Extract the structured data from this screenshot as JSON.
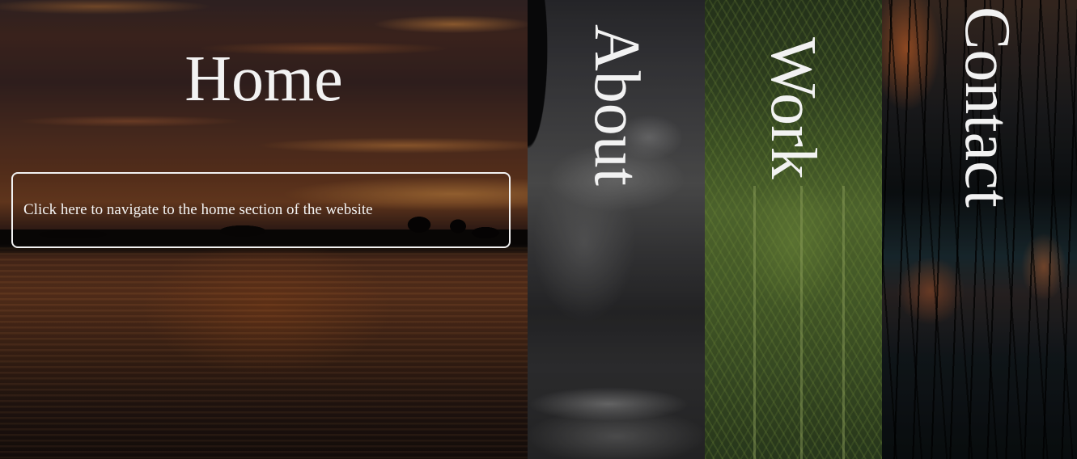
{
  "sections": {
    "home": {
      "title": "Home",
      "description": "Click here to navigate to the home section of the website"
    },
    "about": {
      "title": "About"
    },
    "work": {
      "title": "Work"
    },
    "contact": {
      "title": "Contact"
    }
  },
  "colors": {
    "text": "#f2f2f2",
    "home_tint": "#6a3a22",
    "about_tint": "#4a4a4c",
    "work_tint": "#5a7434",
    "contact_tint": "#12181c"
  }
}
